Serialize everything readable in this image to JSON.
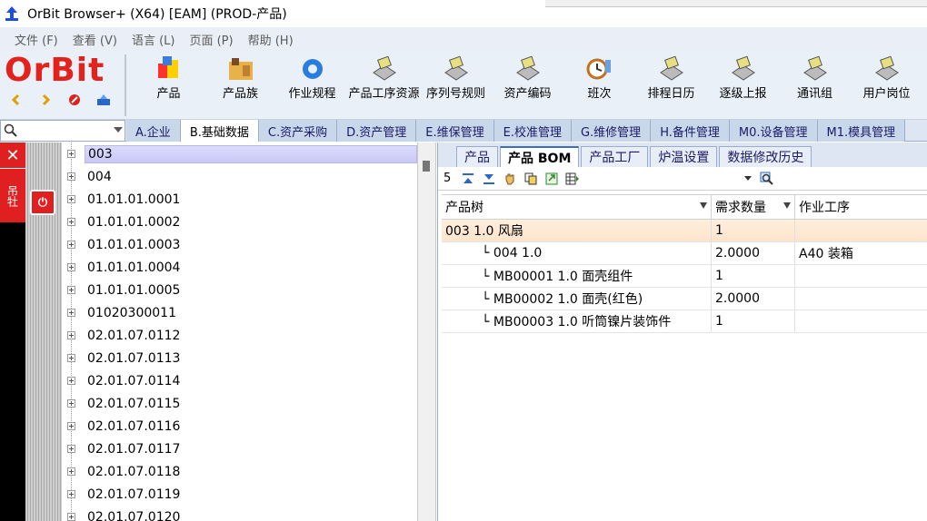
{
  "window": {
    "title": "OrBit Browser+ (X64) [EAM] (PROD-产品)"
  },
  "menu": [
    "文件 (F)",
    "查看 (V)",
    "语言 (L)",
    "页面 (P)",
    "帮助 (H)"
  ],
  "logo": {
    "text": "OrBit"
  },
  "toolbar": {
    "tools": [
      {
        "label": "产品",
        "icon": "product-icon"
      },
      {
        "label": "产品族",
        "icon": "product-family-icon"
      },
      {
        "label": "作业规程",
        "icon": "gear-icon"
      },
      {
        "label": "产品工序资源",
        "icon": "printer-icon"
      },
      {
        "label": "序列号规则",
        "icon": "printer-icon"
      },
      {
        "label": "资产编码",
        "icon": "printer-icon"
      },
      {
        "label": "班次",
        "icon": "clock-icon"
      },
      {
        "label": "排程日历",
        "icon": "printer-icon"
      },
      {
        "label": "逐级上报",
        "icon": "printer-icon"
      },
      {
        "label": "通讯组",
        "icon": "printer-icon"
      },
      {
        "label": "用户岗位",
        "icon": "printer-icon"
      }
    ]
  },
  "modules": {
    "search_placeholder": "",
    "tabs": [
      "A.企业",
      "B.基础数据",
      "C.资产采购",
      "D.资产管理",
      "E.维保管理",
      "E.校准管理",
      "G.维修管理",
      "H.备件管理",
      "M0.设备管理",
      "M1.模具管理"
    ],
    "active": 1
  },
  "leftstrip": {
    "label": "吊牡"
  },
  "tree": {
    "items": [
      "003",
      "004",
      "01.01.01.0001",
      "01.01.01.0002",
      "01.01.01.0003",
      "01.01.01.0004",
      "01.01.01.0005",
      "01020300011",
      "02.01.07.0112",
      "02.01.07.0113",
      "02.01.07.0114",
      "02.01.07.0115",
      "02.01.07.0116",
      "02.01.07.0117",
      "02.01.07.0118",
      "02.01.07.0119",
      "02.01.07.0120"
    ],
    "selected": 0
  },
  "subtabs": {
    "tabs": [
      "产品",
      "产品 BOM",
      "产品工厂",
      "炉温设置",
      "数据修改历史"
    ],
    "active": 1
  },
  "grid": {
    "count": "5",
    "columns": [
      "产品树",
      "需求数量",
      "作业工序"
    ],
    "rows": [
      {
        "tree": "003 1.0 风扇",
        "qty": "1",
        "op": ""
      },
      {
        "tree": "└ 004 1.0",
        "qty": "2.0000",
        "op": "A40 装箱"
      },
      {
        "tree": "└ MB00001 1.0 面壳组件",
        "qty": "1",
        "op": ""
      },
      {
        "tree": "└ MB00002 1.0 面壳(红色)",
        "qty": "2.0000",
        "op": ""
      },
      {
        "tree": "└ MB00003 1.0 听筒镍片装饰件",
        "qty": "1",
        "op": ""
      }
    ]
  },
  "colors": {
    "brand": "#e3221c",
    "toolbar_bg": "#eaf0f8",
    "tab_bg": "#c9d7ea"
  }
}
